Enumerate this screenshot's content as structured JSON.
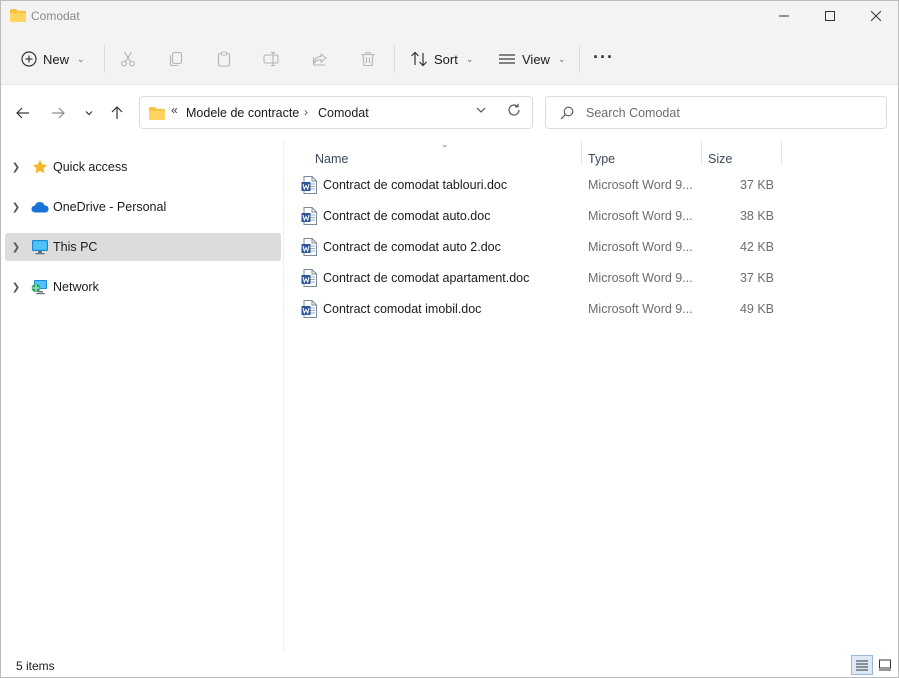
{
  "window": {
    "title": "Comodat",
    "colors": {
      "folder": "#f6c343",
      "accent": "#2b579a",
      "selected": "#dcdcdc"
    }
  },
  "toolbar": {
    "new_label": "New",
    "sort_label": "Sort",
    "view_label": "View",
    "icons": [
      "plus-circle-icon",
      "cut-icon",
      "copy-icon",
      "paste-icon",
      "rename-icon",
      "share-icon",
      "delete-icon",
      "sort-icon",
      "view-icon",
      "more-icon"
    ]
  },
  "address": {
    "overflow": "«",
    "segments": [
      "Modele de contracte",
      "Comodat"
    ]
  },
  "search": {
    "placeholder": "Search Comodat"
  },
  "sidebar": {
    "items": [
      {
        "label": "Quick access",
        "icon": "star-icon",
        "selected": false
      },
      {
        "label": "OneDrive - Personal",
        "icon": "cloud-icon",
        "selected": false
      },
      {
        "label": "This PC",
        "icon": "monitor-icon",
        "selected": true
      },
      {
        "label": "Network",
        "icon": "network-icon",
        "selected": false
      }
    ]
  },
  "list": {
    "columns": [
      "Name",
      "Type",
      "Size"
    ],
    "rows": [
      {
        "name": "Contract de comodat tablouri.doc",
        "type": "Microsoft Word 9...",
        "size": "37 KB"
      },
      {
        "name": "Contract de comodat auto.doc",
        "type": "Microsoft Word 9...",
        "size": "38 KB"
      },
      {
        "name": "Contract de comodat auto 2.doc",
        "type": "Microsoft Word 9...",
        "size": "42 KB"
      },
      {
        "name": "Contract de comodat apartament.doc",
        "type": "Microsoft Word 9...",
        "size": "37 KB"
      },
      {
        "name": "Contract comodat imobil.doc",
        "type": "Microsoft Word 9...",
        "size": "49 KB"
      }
    ]
  },
  "status": {
    "item_count": "5 items"
  }
}
